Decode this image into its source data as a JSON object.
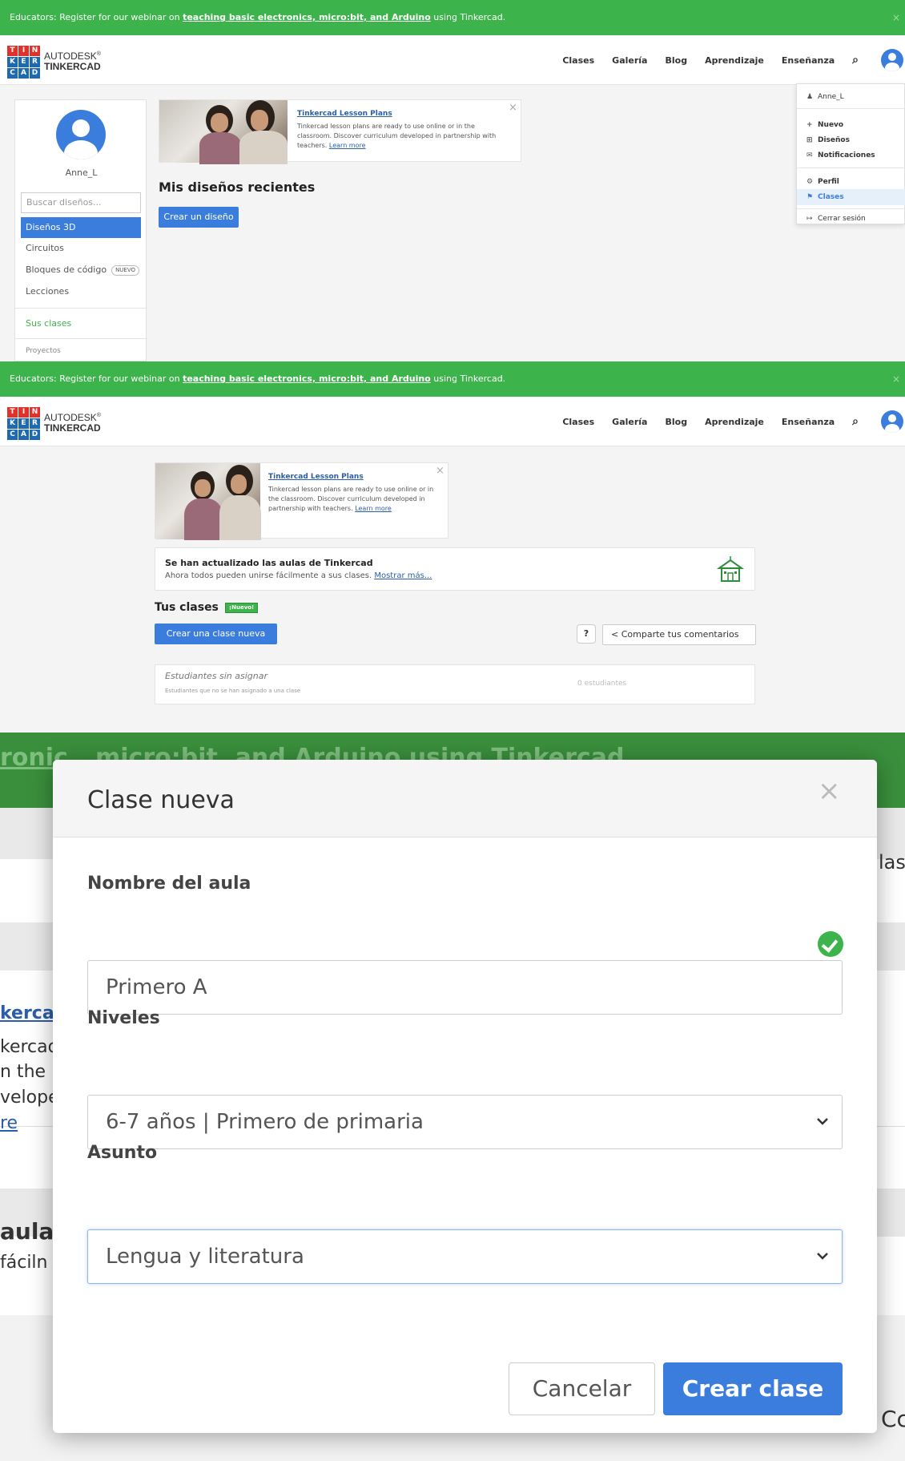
{
  "banner": {
    "prefix": "Educators: Register for our webinar on ",
    "link": "teaching basic electronics, micro:bit, and Arduino",
    "suffix": " using Tinkercad.",
    "close": "×"
  },
  "brand": {
    "line1": "AUTODESK",
    "line1_mark": "®",
    "line2": "TINKERCAD",
    "logo_letters": [
      "T",
      "I",
      "N",
      "K",
      "E",
      "R",
      "C",
      "A",
      "D"
    ],
    "logo_colors": [
      "#e0312b",
      "#e0312b",
      "#e0312b",
      "#1e6ab0",
      "#1e6ab0",
      "#1e6ab0",
      "#1e6ab0",
      "#1e6ab0",
      "#1e6ab0"
    ]
  },
  "nav": {
    "items": [
      "Clases",
      "Galería",
      "Blog",
      "Aprendizaje",
      "Enseñanza"
    ],
    "search_icon": "⌕"
  },
  "dropdown": {
    "user": "Anne_L",
    "items": [
      {
        "icon": "+",
        "label": "Nuevo"
      },
      {
        "icon": "⊞",
        "label": "Diseños"
      },
      {
        "icon": "✉",
        "label": "Notificaciones"
      },
      {
        "icon": "⚙",
        "label": "Perfil"
      },
      {
        "icon": "⚑",
        "label": "Clases"
      },
      {
        "icon": "↦",
        "label": "Cerrar sesión"
      }
    ]
  },
  "sidebar": {
    "username": "Anne_L",
    "search_placeholder": "Buscar diseños...",
    "items": [
      {
        "label": "Diseños 3D"
      },
      {
        "label": "Circuitos"
      },
      {
        "label": "Bloques de código",
        "badge": "NUEVO"
      },
      {
        "label": "Lecciones"
      }
    ],
    "classes_link": "Sus clases",
    "projects": "Proyectos"
  },
  "lesson": {
    "title": "Tinkercad Lesson Plans",
    "text_p1": "Tinkercad lesson plans are ready to use online or in the classroom. Discover curriculum developed in partnership with teachers. ",
    "text_p2": "Tinkercad lesson plans are ready to use online or in the classroom. Discover curriculum developed in partnership with teachers. ",
    "learn_more": "Learn more",
    "close": "×"
  },
  "p1": {
    "heading": "Mis diseños recientes",
    "create_btn": "Crear un diseño"
  },
  "p2": {
    "notice_title": "Se han actualizado las aulas de Tinkercad",
    "notice_text": "Ahora todos pueden unirse fácilmente a sus clases. ",
    "notice_link": "Mostrar más...",
    "heading": "Tus clases",
    "new_tag": "¡Nuevo!",
    "create_btn": "Crear una clase nueva",
    "help": "?",
    "share": "Comparte tus comentarios",
    "unassigned_title": "Estudiantes sin asignar",
    "unassigned_sub": "Estudiantes que no se han asignado a una clase",
    "unassigned_count": "0 estudiantes"
  },
  "bg3": {
    "banner_text": "ronic...micro:bit, and Arduino using Tinkercad",
    "frag_las": "las",
    "frag_lines": [
      "kerca",
      "kercad",
      "n the",
      "velope",
      "re"
    ],
    "frag_aula": "aula",
    "frag_facil": "fáciln",
    "frag_c": "Cc"
  },
  "modal": {
    "title": "Clase nueva",
    "close": "×",
    "name_label": "Nombre del aula",
    "name_value": "Primero A",
    "levels_label": "Niveles",
    "levels_value": "6-7 años | Primero de primaria",
    "subject_label": "Asunto",
    "subject_value": "Lengua y literatura",
    "cancel": "Cancelar",
    "create": "Crear clase"
  }
}
